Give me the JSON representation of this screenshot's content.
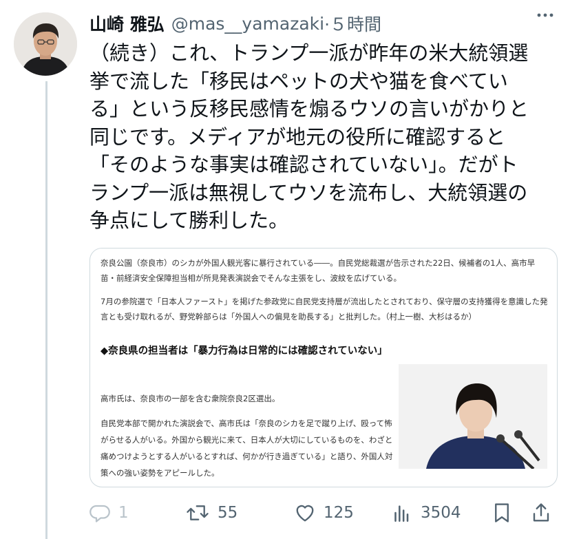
{
  "author": {
    "name": "山崎 雅弘",
    "handle": "@mas__yamazaki",
    "time": "·５時間"
  },
  "tweet_text": "（続き）これ、トランプ一派が昨年の米大統領選\n挙で流した「移民はペットの犬や猫を食べてい\nる」という反移民感情を煽るウソの言いがかりと\n同じです。メディアが地元の役所に確認すると\n「そのような事実は確認されていない」。だがト\nランプ一派は無視してウソを流布し、大統領選の\n争点にして勝利した。",
  "article": {
    "para1": "奈良公園（奈良市）のシカが外国人観光客に暴行されている――。自民党総裁選が告示された22日、候補者の1人、高市早苗・前経済安全保障担当相が所見発表演説会でそんな主張をし、波紋を広げている。",
    "para2": "7月の参院選で「日本人ファースト」を掲げた参政党に自民党支持層が流出したとされており、保守層の支持獲得を意識した発言とも受け取れるが、野党幹部らは「外国人への偏見を助長する」と批判した。（村上一樹、大杉はるか）",
    "subhead": "◆奈良県の担当者は「暴力行為は日常的には確認されていない」",
    "para3": "高市氏は、奈良市の一部を含む衆院奈良2区選出。",
    "para4": "自民党本部で開かれた演説会で、高市氏は「奈良のシカを足で蹴り上げ、殴って怖がらせる人がいる。外国から観光に来て、日本人が大切にしているものを、わざと痛めつけようとする人がいるとすれば、何かが行き過ぎている」と語り、外国人対策への強い姿勢をアピールした。"
  },
  "actions": {
    "reply_count": "1",
    "retweet_count": "55",
    "like_count": "125",
    "view_count": "3504"
  },
  "icons": {
    "more": "more-icon",
    "reply": "reply-icon",
    "retweet": "retweet-icon",
    "like": "like-icon",
    "views": "views-icon",
    "bookmark": "bookmark-icon",
    "share": "share-icon"
  },
  "colors": {
    "text": "#0f1419",
    "muted": "#536471",
    "border": "#cfd9de",
    "reply_faded": "#b9c3ca"
  }
}
